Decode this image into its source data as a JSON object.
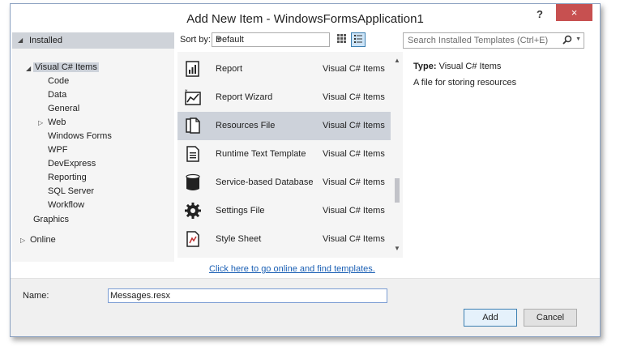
{
  "window": {
    "title": "Add New Item - WindowsFormsApplication1",
    "help_label": "?",
    "close_label": "×"
  },
  "tree": {
    "installed": "Installed",
    "visual_csharp": "Visual C# Items",
    "children": [
      "Code",
      "Data",
      "General",
      "Web",
      "Windows Forms",
      "WPF",
      "DevExpress",
      "Reporting",
      "SQL Server",
      "Workflow"
    ],
    "graphics": "Graphics",
    "online": "Online"
  },
  "toolbar": {
    "sort_label": "Sort by:",
    "sort_value": "Default"
  },
  "search": {
    "placeholder": "Search Installed Templates (Ctrl+E)"
  },
  "templates": [
    {
      "name": "Report",
      "category": "Visual C# Items",
      "icon": "report-icon"
    },
    {
      "name": "Report Wizard",
      "category": "Visual C# Items",
      "icon": "report-wizard-icon"
    },
    {
      "name": "Resources File",
      "category": "Visual C# Items",
      "icon": "resources-file-icon",
      "selected": true
    },
    {
      "name": "Runtime Text Template",
      "category": "Visual C# Items",
      "icon": "text-template-icon"
    },
    {
      "name": "Service-based Database",
      "category": "Visual C# Items",
      "icon": "database-icon"
    },
    {
      "name": "Settings File",
      "category": "Visual C# Items",
      "icon": "gear-icon"
    },
    {
      "name": "Style Sheet",
      "category": "Visual C# Items",
      "icon": "style-sheet-icon"
    }
  ],
  "online_link": "Click here to go online and find templates.",
  "details": {
    "type_label": "Type:",
    "type_value": "Visual C# Items",
    "description": "A file for storing resources"
  },
  "name_field": {
    "label": "Name:",
    "value": "Messages.resx"
  },
  "buttons": {
    "add": "Add",
    "cancel": "Cancel"
  },
  "colors": {
    "close": "#c75050",
    "selection": "#cdd2da",
    "link": "#1a5fb4"
  }
}
